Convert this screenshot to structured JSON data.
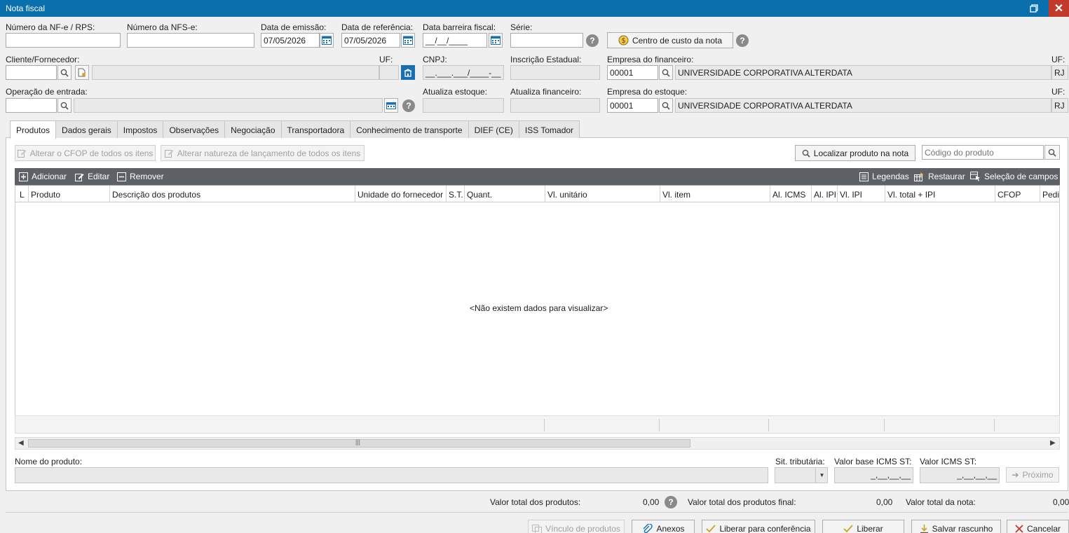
{
  "window": {
    "title": "Nota fiscal"
  },
  "fields": {
    "numero_nfe_label": "Número da NF-e / RPS:",
    "numero_nfs_label": "Número da NFS-e:",
    "data_emissao_label": "Data de emissão:",
    "data_emissao_value": "07/05/2026",
    "data_referencia_label": "Data de referência:",
    "data_referencia_value": "07/05/2026",
    "data_barreira_label": "Data barreira fiscal:",
    "data_barreira_value": "__/__/____",
    "serie_label": "Série:",
    "centro_custo_label": "Centro de custo da nota",
    "cliente_label": "Cliente/Fornecedor:",
    "uf_label": "UF:",
    "cnpj_label": "CNPJ:",
    "cnpj_value": "__.___.___/____-__",
    "inscricao_label": "Inscrição Estadual:",
    "empresa_fin_label": "Empresa do financeiro:",
    "empresa_fin_code": "00001",
    "empresa_fin_name": "UNIVERSIDADE CORPORATIVA ALTERDATA",
    "empresa_fin_uf": "RJ",
    "operacao_label": "Operação de entrada:",
    "atualiza_estoque_label": "Atualiza estoque:",
    "atualiza_financeiro_label": "Atualiza financeiro:",
    "empresa_est_label": "Empresa do estoque:",
    "empresa_est_code": "00001",
    "empresa_est_name": "UNIVERSIDADE CORPORATIVA ALTERDATA",
    "empresa_est_uf": "RJ"
  },
  "tabs": [
    "Produtos",
    "Dados gerais",
    "Impostos",
    "Observações",
    "Negociação",
    "Transportadora",
    "Conhecimento de transporte",
    "DIEF (CE)",
    "ISS Tomador"
  ],
  "products": {
    "alterar_cfop": "Alterar o CFOP de todos os itens",
    "alterar_natureza": "Alterar natureza de lançamento de todos os itens",
    "localizar": "Localizar produto na nota",
    "codigo_placeholder": "Código do produto",
    "toolbar": {
      "adicionar": "Adicionar",
      "editar": "Editar",
      "remover": "Remover",
      "legendas": "Legendas",
      "restaurar": "Restaurar",
      "selecao": "Seleção de campos"
    },
    "columns": [
      "L",
      "Produto",
      "Descrição dos produtos",
      "Unidade do fornecedor",
      "S.T.",
      "Quant.",
      "Vl. unitário",
      "Vl. item",
      "Al. ICMS",
      "Al. IPI",
      "Vl. IPI",
      "Vl. total + IPI",
      "CFOP",
      "Pedi"
    ],
    "empty_message": "<Não existem dados para visualizar>",
    "nome_produto_label": "Nome do produto:",
    "sit_tributaria_label": "Sit. tributária:",
    "valor_base_label": "Valor base ICMS ST:",
    "valor_base_value": "_,__,__,__",
    "valor_icms_label": "Valor ICMS ST:",
    "valor_icms_value": "_,__,__,__",
    "proximo": "Próximo"
  },
  "totals": {
    "produtos_label": "Valor total dos produtos:",
    "produtos_value": "0,00",
    "produtos_final_label": "Valor total dos produtos final:",
    "produtos_final_value": "0,00",
    "nota_label": "Valor total da nota:",
    "nota_value": "0,00"
  },
  "bottom_buttons": {
    "vinculo": "Vínculo de produtos",
    "anexos": "Anexos",
    "liberar_conf": "Liberar para conferência",
    "liberar": "Liberar",
    "salvar": "Salvar rascunho",
    "cancelar": "Cancelar"
  }
}
